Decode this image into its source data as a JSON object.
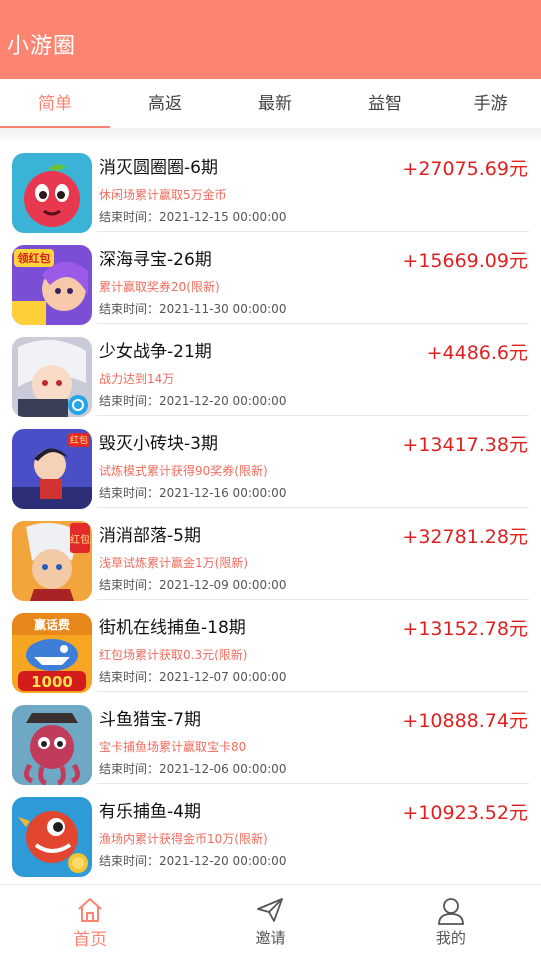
{
  "header": {
    "title": "小游圈"
  },
  "tabs": [
    {
      "label": "简单",
      "active": true
    },
    {
      "label": "高返",
      "active": false
    },
    {
      "label": "最新",
      "active": false
    },
    {
      "label": "益智",
      "active": false
    },
    {
      "label": "手游",
      "active": false
    }
  ],
  "games": [
    {
      "name": "消灭圆圈圈-6期",
      "desc": "休闲场累计赢取5万金币",
      "end": "结束时间：2021-12-15 00:00:00",
      "amount": "+27075.69元"
    },
    {
      "name": "深海寻宝-26期",
      "desc": "累计赢取奖券20(限新)",
      "end": "结束时间：2021-11-30 00:00:00",
      "amount": "+15669.09元",
      "badge": "领红包"
    },
    {
      "name": "少女战争-21期",
      "desc": "战力达到14万",
      "end": "结束时间：2021-12-20 00:00:00",
      "amount": "+4486.6元"
    },
    {
      "name": "毁灭小砖块-3期",
      "desc": "试炼模式累计获得90奖券(限新)",
      "end": "结束时间：2021-12-16 00:00:00",
      "amount": "+13417.38元",
      "badge": "红包"
    },
    {
      "name": "消消部落-5期",
      "desc": "浅草试炼累计赢金1万(限新)",
      "end": "结束时间：2021-12-09 00:00:00",
      "amount": "+32781.28元",
      "badge": "红包"
    },
    {
      "name": "街机在线捕鱼-18期",
      "desc": "红包场累计获取0.3元(限新)",
      "end": "结束时间：2021-12-07 00:00:00",
      "amount": "+13152.78元",
      "badge": "赢话费",
      "badge2": "1000"
    },
    {
      "name": "斗鱼猎宝-7期",
      "desc": "宝卡捕鱼场累计赢取宝卡80",
      "end": "结束时间：2021-12-06 00:00:00",
      "amount": "+10888.74元"
    },
    {
      "name": "有乐捕鱼-4期",
      "desc": "渔场内累计获得金币10万(限新)",
      "end": "结束时间：2021-12-20 00:00:00",
      "amount": "+10923.52元"
    }
  ],
  "bottom_nav": [
    {
      "label": "首页",
      "icon": "home-icon",
      "active": true
    },
    {
      "label": "邀请",
      "icon": "send-icon",
      "active": false
    },
    {
      "label": "我的",
      "icon": "user-icon",
      "active": false
    }
  ],
  "colors": {
    "brand": "#fc8471",
    "amount": "#e02020",
    "desc": "#f06c5e"
  }
}
